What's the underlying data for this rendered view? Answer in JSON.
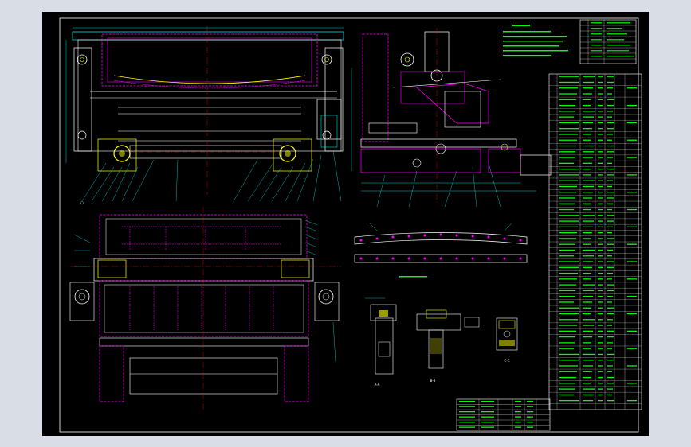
{
  "colors": {
    "background": "#000000",
    "window_frame": "#d8dde6",
    "frame_line": "#ffffff",
    "steel": "#ff00ff",
    "dim": "#00ffff",
    "note": "#00ff00",
    "center": "#ff0000",
    "part": "#ffff00",
    "border": "#ffffff"
  },
  "drawing": {
    "view_labels": [
      "A-A",
      "B-B",
      "C-C"
    ]
  }
}
